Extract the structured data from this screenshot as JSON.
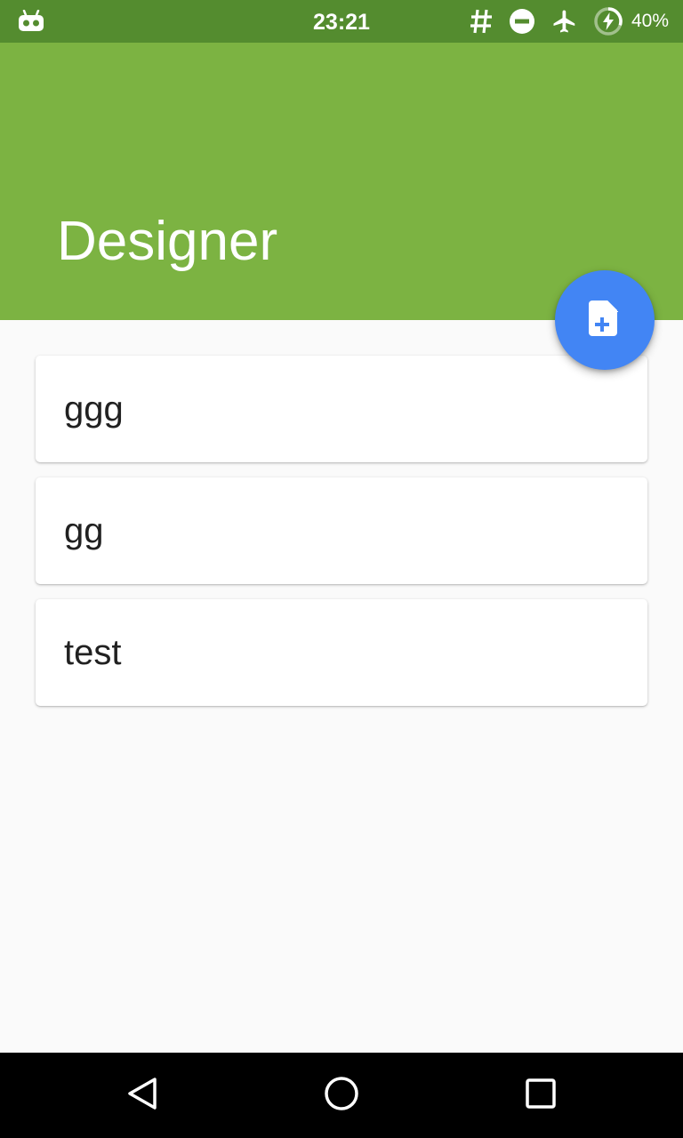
{
  "status_bar": {
    "time": "23:21",
    "battery": "40%",
    "icons": [
      "notification-robot-icon",
      "hash-icon",
      "do-not-disturb-icon",
      "airplane-mode-icon",
      "battery-charging-icon"
    ]
  },
  "app_bar": {
    "title": "Designer"
  },
  "fab": {
    "icon": "new-document-icon"
  },
  "items": [
    {
      "label": "ggg"
    },
    {
      "label": "gg"
    },
    {
      "label": "test"
    }
  ],
  "nav_bar": {
    "icons": [
      "back-icon",
      "home-icon",
      "recents-icon"
    ]
  },
  "colors": {
    "status_bar": "#548c2f",
    "app_bar": "#7cb342",
    "fab": "#4285f4",
    "background": "#fafafa"
  }
}
